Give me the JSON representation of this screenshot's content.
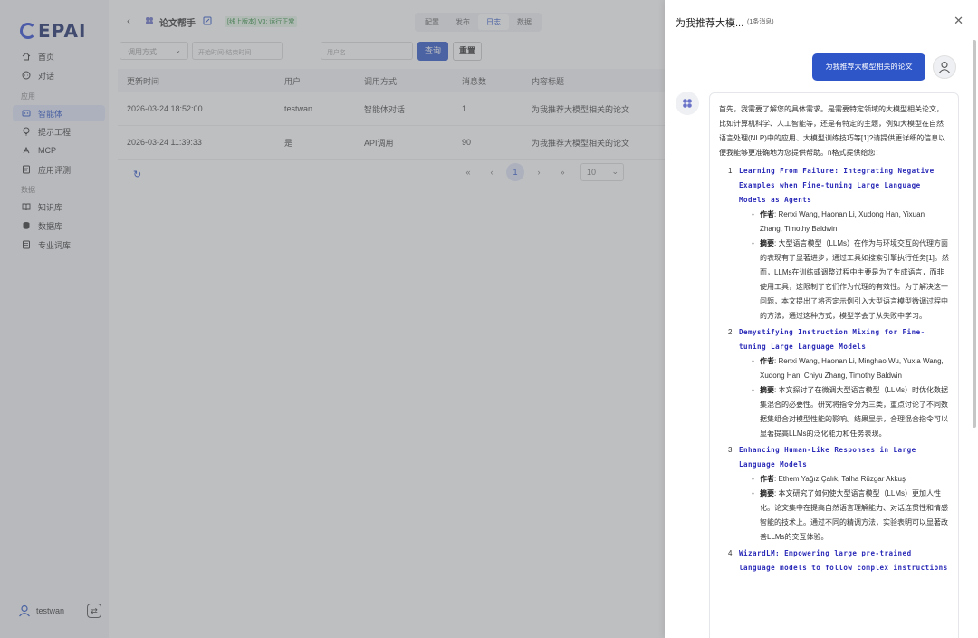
{
  "sidebar": {
    "logo": "EPAI",
    "items": [
      {
        "label": "首页",
        "icon": "home-icon"
      },
      {
        "label": "对话",
        "icon": "chat-icon"
      }
    ],
    "section_app": "应用",
    "app_items": [
      {
        "label": "智能体",
        "icon": "agent-icon",
        "active": true
      },
      {
        "label": "提示工程",
        "icon": "bulb-icon"
      },
      {
        "label": "MCP",
        "icon": "mcp-icon"
      },
      {
        "label": "应用评测",
        "icon": "eval-icon"
      }
    ],
    "section_data": "数据",
    "data_items": [
      {
        "label": "知识库",
        "icon": "knowledge-icon"
      },
      {
        "label": "数据库",
        "icon": "database-icon"
      },
      {
        "label": "专业词库",
        "icon": "dictionary-icon"
      }
    ],
    "user": "testwan"
  },
  "header": {
    "title": "论文帮手",
    "version_badge": "[线上版本] V3: 运行正常",
    "tabs": [
      "配置",
      "发布",
      "日志",
      "数据"
    ],
    "active_tab": "日志"
  },
  "filters": {
    "call_type_placeholder": "调用方式",
    "date_placeholder": "开始时间-结束时间",
    "user_placeholder": "用户名",
    "query_label": "查询",
    "reset_label": "重置"
  },
  "table": {
    "columns": [
      "更新时间",
      "用户",
      "调用方式",
      "消息数",
      "内容标题"
    ],
    "rows": [
      {
        "time": "2026-03-24 18:52:00",
        "user": "testwan",
        "method": "智能体对话",
        "count": "1",
        "title": "为我推荐大模型相关的论文"
      },
      {
        "time": "2026-03-24 11:39:33",
        "user": "是",
        "method": "API调用",
        "count": "90",
        "title": "为我推荐大模型相关的论文"
      }
    ]
  },
  "pagination": {
    "current": "1",
    "page_size": "10"
  },
  "drawer": {
    "title": "为我推荐大模...",
    "count": "(1条消息)",
    "user_message": "为我推荐大模型相关的论文",
    "bot_intro": "首先，我需要了解您的具体需求。是需要特定领域的大模型相关论文，比如计算机科学、人工智能等，还是有特定的主题，例如大模型在自然语言处理(NLP)中的应用、大模型训练技巧等[1]?请提供更详细的信息以便我能够更准确地为您提供帮助。n格式提供给您：",
    "papers": [
      {
        "num": "1.",
        "title": "Learning From Failure: Integrating Negative Examples when Fine-tuning Large Language Models as Agents",
        "author_label": "作者",
        "authors": ": Renxi Wang, Haonan Li, Xudong Han, Yixuan Zhang, Timothy Baldwin",
        "abstract_label": "摘要",
        "abstract": ": 大型语言模型（LLMs）在作为与环境交互的代理方面的表现有了显著进步，通过工具如搜索引擎执行任务[1]。然而，LLMs在训练或调整过程中主要是为了生成语言，而非使用工具，这限制了它们作为代理的有效性。为了解决这一问题，本文提出了将否定示例引入大型语言模型微调过程中的方法，通过这种方式，模型学会了从失败中学习。"
      },
      {
        "num": "2.",
        "title": "Demystifying Instruction Mixing for Fine-tuning Large Language Models",
        "author_label": "作者",
        "authors": ": Renxi Wang, Haonan Li, Minghao Wu, Yuxia Wang, Xudong Han, Chiyu Zhang, Timothy Baldwin",
        "abstract_label": "摘要",
        "abstract": ": 本文探讨了在微调大型语言模型（LLMs）时优化数据集混合的必要性。研究将指令分为三类，重点讨论了不同数据集组合对模型性能的影响。结果显示，合理混合指令可以显著提高LLMs的泛化能力和任务表现。"
      },
      {
        "num": "3.",
        "title": "Enhancing Human-Like Responses in Large Language Models",
        "author_label": "作者",
        "authors": ": Ethem Yağız Çalık, Talha Rüzgar Akkuş",
        "abstract_label": "摘要",
        "abstract": ": 本文研究了如何使大型语言模型（LLMs）更加人性化。论文集中在提高自然语言理解能力、对话连贯性和情感智能的技术上。通过不同的精调方法，实验表明可以显著改善LLMs的交互体验。"
      },
      {
        "num": "4.",
        "title": "WizardLM: Empowering large pre-trained language models to follow complex instructions",
        "author_label": "",
        "authors": "",
        "abstract_label": "",
        "abstract": ""
      }
    ]
  }
}
